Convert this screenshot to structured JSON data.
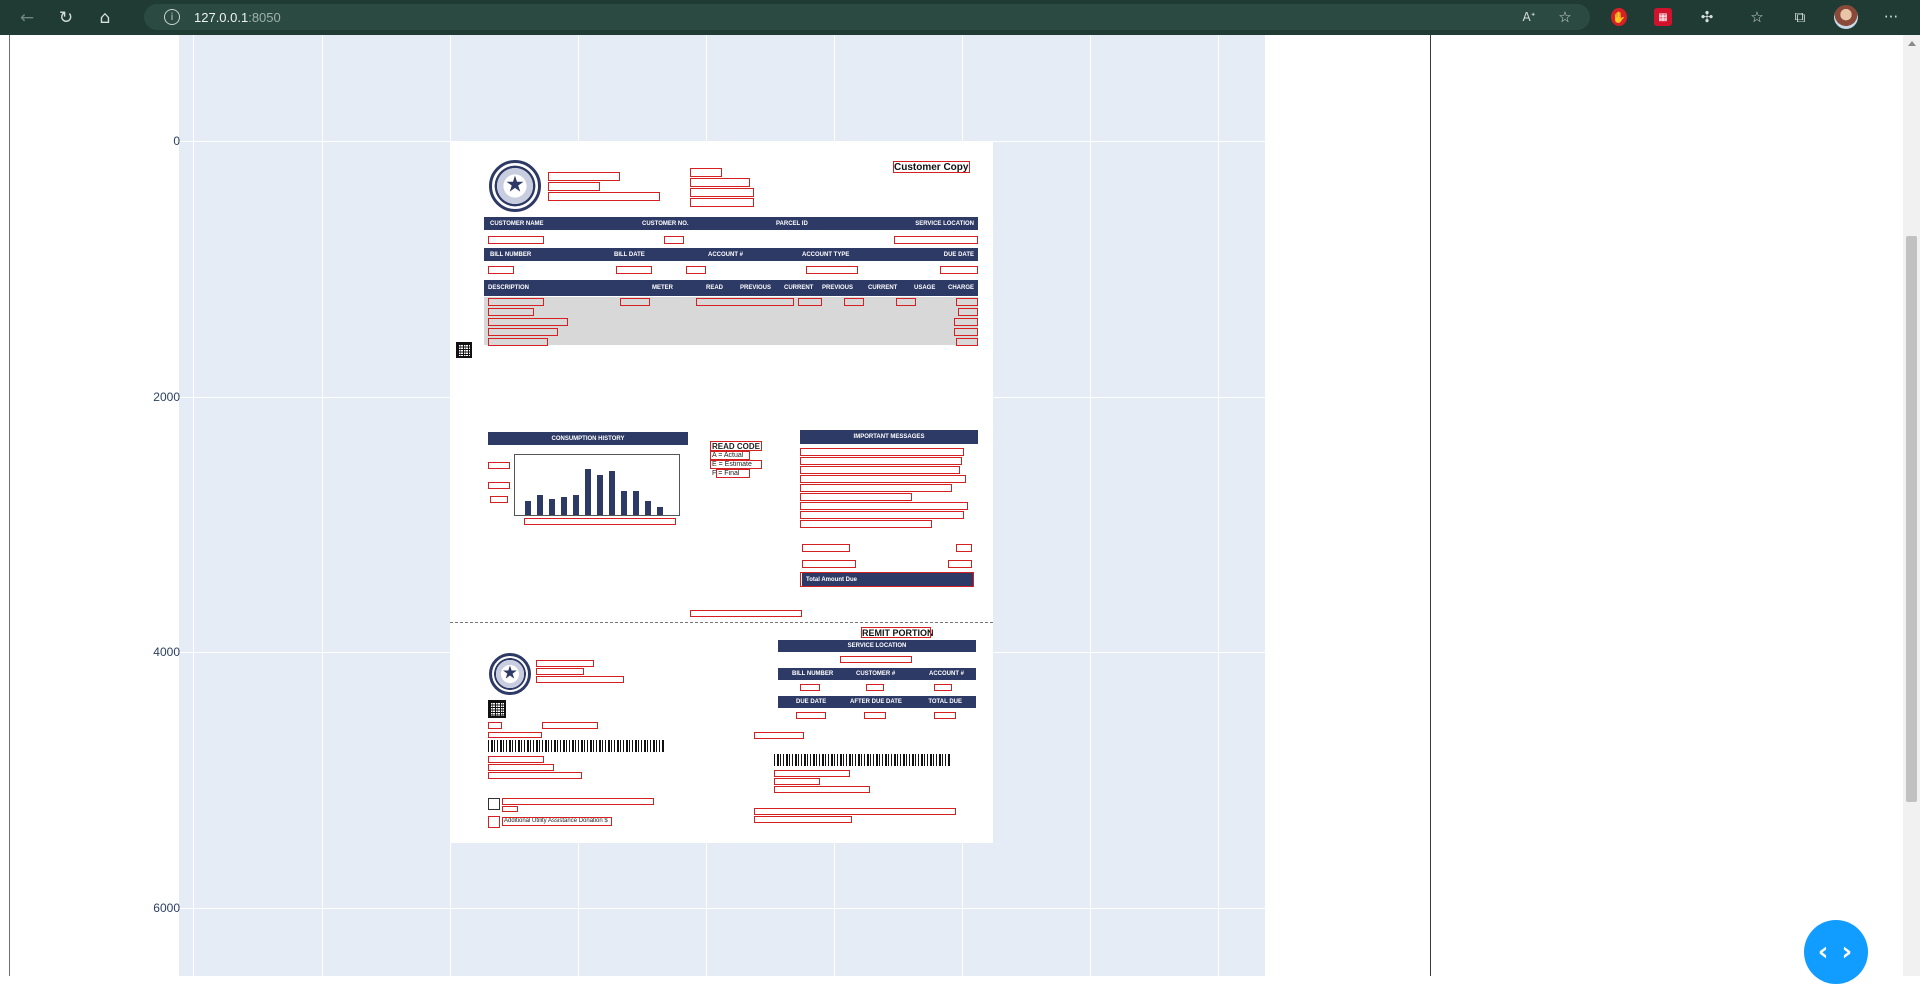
{
  "browser": {
    "url_host": "127.0.0.1",
    "url_port": ":8050",
    "icons": [
      "back-arrow-icon",
      "refresh-icon",
      "home-icon",
      "info-icon",
      "read-aloud-icon",
      "favorite-add-icon",
      "extension-icon",
      "favorites-icon",
      "collections-icon",
      "more-icon"
    ]
  },
  "plot": {
    "y_ticks": [
      "0",
      "2000",
      "4000",
      "6000"
    ],
    "background_color": "#e5ecf6"
  },
  "document": {
    "header_right": "Customer Copy",
    "remit_title": "REMIT PORTION",
    "consumption_title": "CONSUMPTION HISTORY",
    "messages_title": "IMPORTANT MESSAGES",
    "read_code_title": "READ CODE",
    "read_code_items": [
      "A = Actual",
      "E = Estimate",
      "F = Final"
    ],
    "total_label": "Total Amount Due",
    "service_location_label": "SERVICE LOCATION",
    "description_label": "DESCRIPTION",
    "additional_label": "Additional Utility Assistance Donation $"
  },
  "fab": {
    "label": "‹ ›"
  }
}
